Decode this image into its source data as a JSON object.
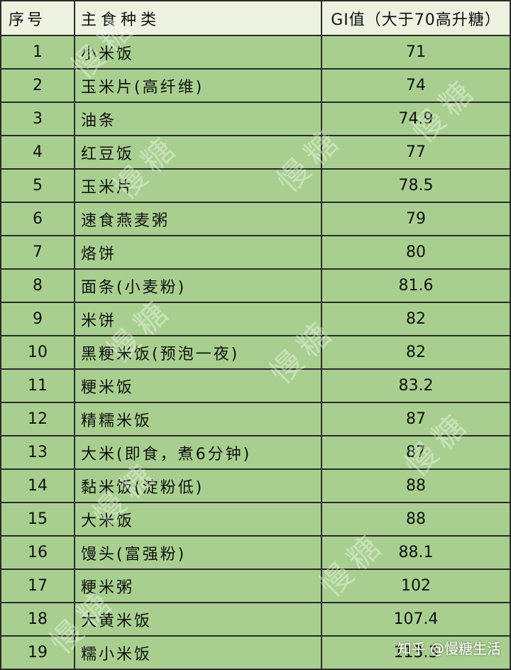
{
  "table": {
    "headers": {
      "no": "序号",
      "food": "主食种类",
      "gi": "GI值（大于70高升糖）"
    },
    "rows": [
      {
        "no": "1",
        "food": "小米饭",
        "gi": "71"
      },
      {
        "no": "2",
        "food": "玉米片(高纤维)",
        "gi": "74"
      },
      {
        "no": "3",
        "food": "油条",
        "gi": "74.9"
      },
      {
        "no": "4",
        "food": "红豆饭",
        "gi": "77"
      },
      {
        "no": "5",
        "food": "玉米片",
        "gi": "78.5"
      },
      {
        "no": "6",
        "food": "速食燕麦粥",
        "gi": "79"
      },
      {
        "no": "7",
        "food": "烙饼",
        "gi": "80"
      },
      {
        "no": "8",
        "food": "面条(小麦粉)",
        "gi": "81.6"
      },
      {
        "no": "9",
        "food": "米饼",
        "gi": "82"
      },
      {
        "no": "10",
        "food": "黑粳米饭(预泡一夜)",
        "gi": "82"
      },
      {
        "no": "11",
        "food": "粳米饭",
        "gi": "83.2"
      },
      {
        "no": "12",
        "food": "精糯米饭",
        "gi": "87"
      },
      {
        "no": "13",
        "food": "大米(即食，煮6分钟)",
        "gi": "87"
      },
      {
        "no": "14",
        "food": "黏米饭(淀粉低)",
        "gi": "88"
      },
      {
        "no": "15",
        "food": "大米饭",
        "gi": "88"
      },
      {
        "no": "16",
        "food": "馒头(富强粉)",
        "gi": "88.1"
      },
      {
        "no": "17",
        "food": "粳米粥",
        "gi": "102"
      },
      {
        "no": "18",
        "food": "大黄米饭",
        "gi": "107.4"
      },
      {
        "no": "19",
        "food": "糯小米饭",
        "gi": "113.3"
      }
    ]
  },
  "watermark": {
    "text": "慢糖"
  },
  "credit": {
    "text": "知乎 @慢糖生活"
  },
  "colors": {
    "header_bg": "#edf2e0",
    "row_bg": "#a8cf8f",
    "border": "#2b2b2b"
  }
}
